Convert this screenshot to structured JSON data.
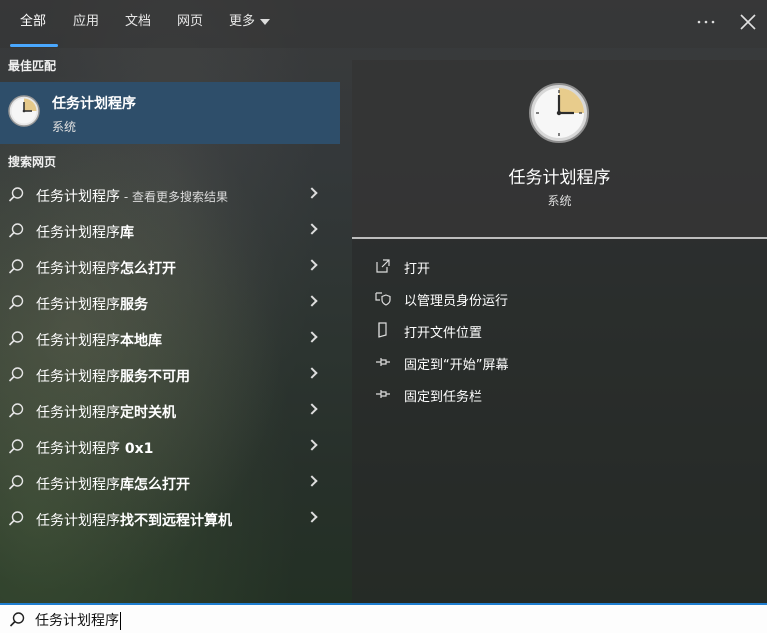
{
  "tabs": [
    {
      "label": "全部",
      "active": true
    },
    {
      "label": "应用",
      "active": false
    },
    {
      "label": "文档",
      "active": false
    },
    {
      "label": "网页",
      "active": false
    },
    {
      "label": "更多",
      "active": false
    }
  ],
  "top_actions": {
    "more_icon": "ellipsis-icon",
    "close_icon": "close-icon"
  },
  "best_match": {
    "header": "最佳匹配",
    "title": "任务计划程序",
    "subtitle": "系统",
    "icon": "clock-icon"
  },
  "web_search": {
    "header": "搜索网页",
    "items": [
      {
        "base": "任务计划程序",
        "extra": "",
        "muted": " - 查看更多搜索结果"
      },
      {
        "base": "任务计划程序",
        "extra": "库",
        "muted": ""
      },
      {
        "base": "任务计划程序",
        "extra": "怎么打开",
        "muted": ""
      },
      {
        "base": "任务计划程序",
        "extra": "服务",
        "muted": ""
      },
      {
        "base": "任务计划程序",
        "extra": "本地库",
        "muted": ""
      },
      {
        "base": "任务计划程序",
        "extra": "服务不可用",
        "muted": ""
      },
      {
        "base": "任务计划程序",
        "extra": "定时关机",
        "muted": ""
      },
      {
        "base": "任务计划程序",
        "extra": " 0x1",
        "muted": ""
      },
      {
        "base": "任务计划程序",
        "extra": "库怎么打开",
        "muted": ""
      },
      {
        "base": "任务计划程序",
        "extra": "找不到远程计算机",
        "muted": ""
      }
    ]
  },
  "detail": {
    "title": "任务计划程序",
    "subtitle": "系统",
    "actions": [
      {
        "label": "打开",
        "icon": "open-external-icon"
      },
      {
        "label": "以管理员身份运行",
        "icon": "shield-icon"
      },
      {
        "label": "打开文件位置",
        "icon": "file-location-icon"
      },
      {
        "label": "固定到“开始”屏幕",
        "icon": "pin-icon"
      },
      {
        "label": "固定到任务栏",
        "icon": "pin-icon"
      }
    ]
  },
  "search": {
    "value": "任务计划程序",
    "icon": "search-icon"
  },
  "colors": {
    "accent": "#1f7ed0",
    "selected": "#2e4e6a",
    "tab_underline": "#4aa8ff"
  }
}
